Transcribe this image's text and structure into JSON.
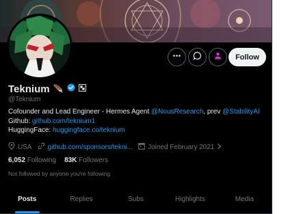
{
  "profile": {
    "name": "Teknium",
    "name_emoji": "🪶",
    "handle": "@Teknium",
    "verified": true,
    "colors": {
      "accent": "#1d9bf0",
      "background": "#000000",
      "text": "#e7e9ea",
      "muted": "#71767b",
      "verified_badge": "#1d9bf0",
      "follow_bg": "#eff3f4",
      "subscribe_icon": "#c936cc"
    }
  },
  "actions": {
    "more_icon": "more-horizontal-icon",
    "message_icon": "message-icon",
    "subscribe_icon": "subscribe-icon",
    "follow_label": "Follow"
  },
  "bio": {
    "line1_prefix": "Cofounder and Lead Engineer - Hermes Agent ",
    "line1_mention1": "@NousResearch",
    "line1_mid": ", prev ",
    "line1_mention2": "@StabilityAI",
    "line2_label": "Github: ",
    "line2_link": "github.com/teknium1",
    "line3_label": "HuggingFace: ",
    "line3_link": "huggingface.co/teknium"
  },
  "meta": {
    "location": "USA",
    "website": "github.com/sponsors/tekni...",
    "joined": "Joined February 2021"
  },
  "stats": {
    "following_count": "6,052",
    "following_label": "Following",
    "followers_count": "83K",
    "followers_label": "Followers"
  },
  "not_followed_text": "Not followed by anyone you're following",
  "tabs": [
    {
      "label": "Posts",
      "active": true
    },
    {
      "label": "Replies",
      "active": false
    },
    {
      "label": "Subs",
      "active": false
    },
    {
      "label": "Highlights",
      "active": false
    },
    {
      "label": "Media",
      "active": false
    }
  ]
}
